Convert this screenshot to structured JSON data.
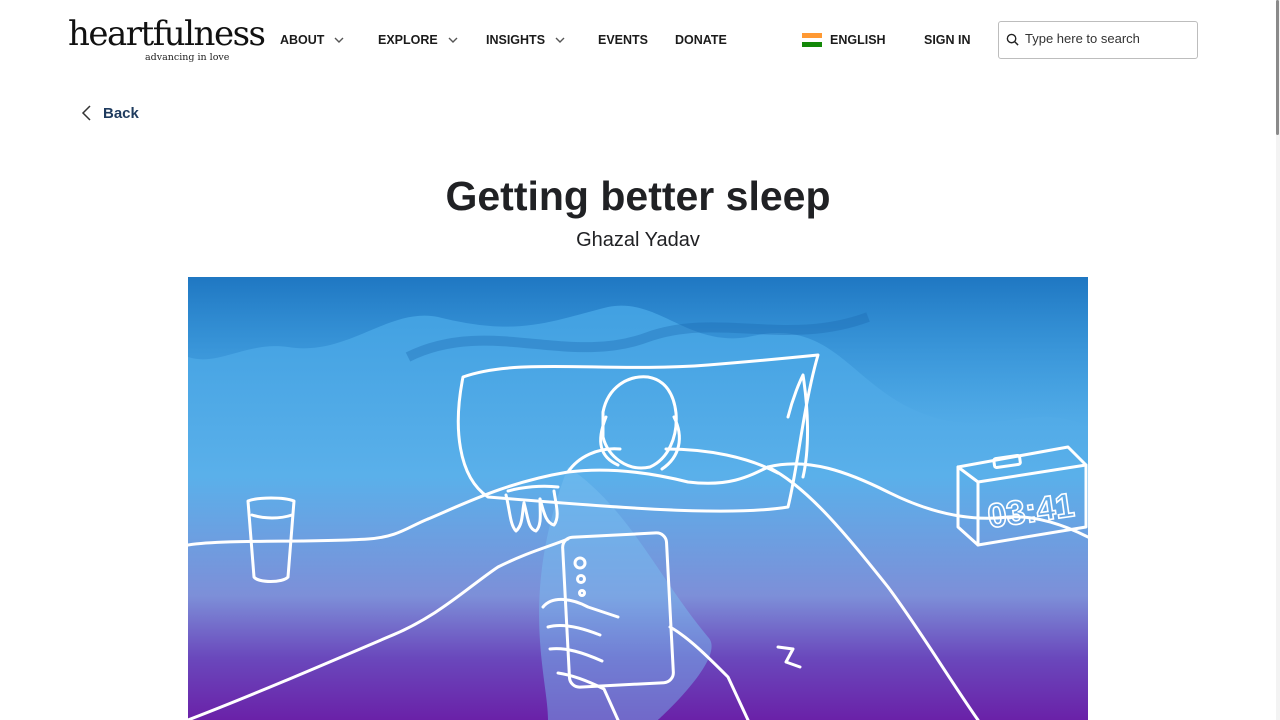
{
  "brand": {
    "name": "heartfulness",
    "tagline": "advancing in love"
  },
  "nav": {
    "items": [
      {
        "label": "ABOUT",
        "has_dropdown": true
      },
      {
        "label": "EXPLORE",
        "has_dropdown": true
      },
      {
        "label": "INSIGHTS",
        "has_dropdown": true
      },
      {
        "label": "EVENTS",
        "has_dropdown": false
      },
      {
        "label": "DONATE",
        "has_dropdown": false
      }
    ],
    "language": "ENGLISH",
    "sign_in": "SIGN IN",
    "search": {
      "placeholder": "Type here to search",
      "value": ""
    }
  },
  "article": {
    "back_label": "Back",
    "title": "Getting better sleep",
    "author": "Ghazal Yadav",
    "hero_image": {
      "clock_display": "03:41",
      "icon": "illustration-person-in-bed-with-phone"
    }
  },
  "colors": {
    "back_link": "#1f3b5e",
    "hero_top": "#2f8fd6",
    "hero_bottom": "#6a21a8",
    "flag": [
      "#ff9933",
      "#ffffff",
      "#138808"
    ]
  }
}
